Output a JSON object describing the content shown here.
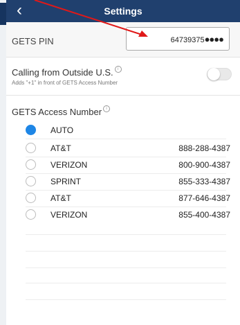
{
  "header": {
    "title": "Settings",
    "back_icon": "chevron-left-icon"
  },
  "gets_pin": {
    "label": "GETS PIN",
    "digits": "64739375",
    "masked": "●●●●"
  },
  "calling_outside": {
    "label": "Calling from Outside U.S.",
    "info_icon": "info-icon",
    "subtitle": "Adds \"+1\" in front of GETS Access Number",
    "toggle_on": false
  },
  "access": {
    "label": "GETS Access Number",
    "info_icon": "info-icon",
    "options": [
      {
        "name": "AUTO",
        "number": "",
        "selected": true
      },
      {
        "name": "AT&T",
        "number": "888-288-4387",
        "selected": false
      },
      {
        "name": "VERIZON",
        "number": "800-900-4387",
        "selected": false
      },
      {
        "name": "SPRINT",
        "number": "855-333-4387",
        "selected": false
      },
      {
        "name": "AT&T",
        "number": "877-646-4387",
        "selected": false
      },
      {
        "name": "VERIZON",
        "number": "855-400-4387",
        "selected": false
      }
    ]
  },
  "colors": {
    "header": "#20406e",
    "accent": "#1e86e6",
    "annotation_arrow": "#e01919"
  }
}
